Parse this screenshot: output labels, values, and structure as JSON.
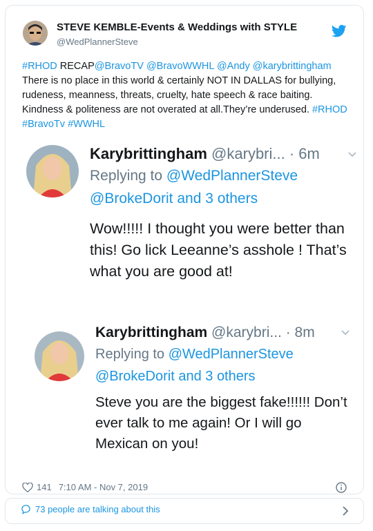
{
  "tweet": {
    "author_name": "STEVE KEMBLE-Events & Weddings with STYLE",
    "author_handle": "@WedPlannerSteve",
    "text_parts": [
      {
        "t": "#RHOD",
        "hl": true
      },
      {
        "t": " RECAP",
        "hl": false
      },
      {
        "t": "@BravoTV",
        "hl": true
      },
      {
        "t": " ",
        "hl": false
      },
      {
        "t": "@BravoWWHL",
        "hl": true
      },
      {
        "t": " ",
        "hl": false
      },
      {
        "t": "@Andy",
        "hl": true
      },
      {
        "t": " ",
        "hl": false
      },
      {
        "t": "@karybrittingham",
        "hl": true
      },
      {
        "t": " There is no place in this world & certainly NOT IN DALLAS for bullying, rudeness, meanness, threats, cruelty, hate speech & race baiting. Kindness & politeness are not overated at all.They’re underused. ",
        "hl": false
      },
      {
        "t": "#RHOD",
        "hl": true
      },
      {
        "t": " ",
        "hl": false
      },
      {
        "t": "#BravoTv",
        "hl": true
      },
      {
        "t": " ",
        "hl": false
      },
      {
        "t": "#WWHL",
        "hl": true
      }
    ],
    "likes": "141",
    "timestamp": "7:10 AM - Nov 7, 2019"
  },
  "replies": [
    {
      "name": "Karybrittingham",
      "handle": "@karybri...",
      "time": "· 6m",
      "replying_prefix": "Replying to ",
      "replying_to": "@WedPlannerSteve",
      "others": "@BrokeDorit and 3 others",
      "body": "Wow!!!!! I thought you were better than this! Go lick Leeanne’s asshole ! That’s what you are good at!"
    },
    {
      "name": "Karybrittingham",
      "handle": "@karybri...",
      "time": "· 8m",
      "replying_prefix": "Replying to ",
      "replying_to": "@WedPlannerSteve",
      "others": "@BrokeDorit and 3 others",
      "body": "Steve you are the biggest fake!!!!!! Don’t ever talk to me again! Or I will go Mexican on you!"
    }
  ],
  "footer": {
    "talking": "73 people are talking about this"
  },
  "colors": {
    "accent": "#1b95e0",
    "text": "#14171a",
    "muted": "#657786",
    "border": "#e1e8ed"
  }
}
